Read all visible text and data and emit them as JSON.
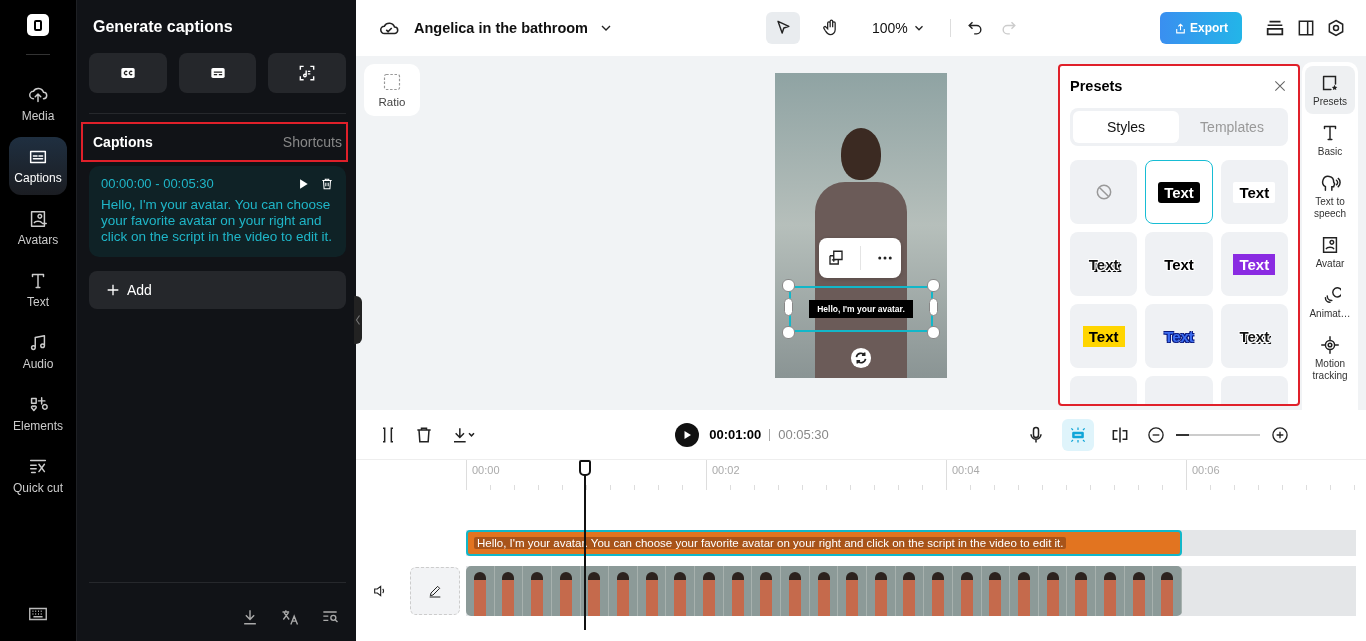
{
  "rail": {
    "items": [
      {
        "label": "Media",
        "selected": false
      },
      {
        "label": "Captions",
        "selected": true
      },
      {
        "label": "Avatars",
        "selected": false
      },
      {
        "label": "Text",
        "selected": false
      },
      {
        "label": "Audio",
        "selected": false
      },
      {
        "label": "Elements",
        "selected": false
      },
      {
        "label": "Quick cut",
        "selected": false
      }
    ]
  },
  "captions_panel": {
    "title": "Generate captions",
    "header": {
      "title": "Captions",
      "link": "Shortcuts",
      "highlighted": true
    },
    "entries": [
      {
        "time_range": "00:00:00 - 00:05:30",
        "text": "Hello, I'm your avatar. You can choose your favorite avatar on your right and click on the script in the video to edit it."
      }
    ],
    "add_button": "Add"
  },
  "topbar": {
    "project_title": "Angelica in the bathroom",
    "zoom": "100%",
    "export": "Export"
  },
  "canvas": {
    "ratio_button": "Ratio",
    "caption_overlay": "Hello, I'm your avatar."
  },
  "presets": {
    "title": "Presets",
    "highlighted": true,
    "tabs": [
      {
        "label": "Styles",
        "selected": true
      },
      {
        "label": "Templates",
        "selected": false
      }
    ],
    "styles": [
      {
        "kind": "none",
        "selected": false
      },
      {
        "kind": "black-box",
        "label": "Text",
        "selected": true
      },
      {
        "kind": "white-box",
        "label": "Text",
        "selected": false
      },
      {
        "kind": "heavy-outline",
        "label": "Text",
        "selected": false
      },
      {
        "kind": "white-outline",
        "label": "Text",
        "selected": false
      },
      {
        "kind": "purple-box",
        "label": "Text",
        "selected": false
      },
      {
        "kind": "yellow-box",
        "label": "Text",
        "selected": false
      },
      {
        "kind": "blue-outline",
        "label": "Text",
        "selected": false
      },
      {
        "kind": "dark-outline",
        "label": "Text",
        "selected": false
      },
      {
        "kind": "blank",
        "selected": false
      },
      {
        "kind": "blank",
        "selected": false
      },
      {
        "kind": "blank",
        "selected": false
      }
    ]
  },
  "side_tabs": [
    {
      "label": "Presets",
      "selected": true
    },
    {
      "label": "Basic",
      "selected": false
    },
    {
      "label": "Text to speech",
      "selected": false
    },
    {
      "label": "Avatar",
      "selected": false
    },
    {
      "label": "Animat…",
      "selected": false
    },
    {
      "label": "Motion tracking",
      "selected": false
    }
  ],
  "playback": {
    "current": "00:01:00",
    "total": "00:05:30",
    "zoom_slider": {
      "level": 0.15
    }
  },
  "timeline": {
    "ruler": [
      "00:00",
      "00:02",
      "00:04",
      "00:06"
    ],
    "caption_clip": "Hello, I'm your avatar. You can choose your favorite avatar on your right and click on the script in the video to edit it."
  }
}
